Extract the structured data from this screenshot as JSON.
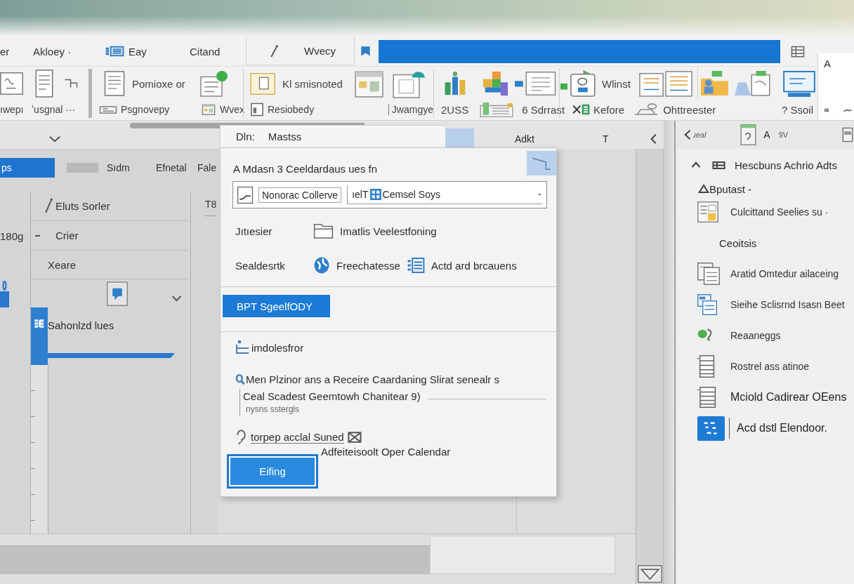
{
  "ribbon": {
    "tabs": [
      {
        "label": "er",
        "selected": false
      },
      {
        "label": "Akloey ·",
        "selected": false
      },
      {
        "label": "Eay",
        "selected": false
      },
      {
        "label": "Citand",
        "selected": false
      },
      {
        "label": "Wvecy",
        "selected": false
      }
    ],
    "top_commands": [
      "Pomioxe or",
      "Kl smisnoted",
      "Wlinst"
    ],
    "bottom_commands": [
      "ıwepı",
      "ʻusgnal ···",
      "Psgnovepy",
      "Wvex",
      "Resiobedy",
      "Jwamgye",
      "2USS",
      "6 Sdrrast",
      "Kefore",
      "Ohttreester",
      "? Ssoil"
    ],
    "side_label": "A"
  },
  "content_header": [
    "Adkt",
    "T"
  ],
  "calendar": {
    "tabs": [
      {
        "label": "ps",
        "selected": true
      },
      {
        "label": "Sıdm",
        "selected": false
      },
      {
        "label": "Efnetal",
        "selected": false
      },
      {
        "label": "Fale",
        "selected": false
      }
    ],
    "rows": [
      {
        "title": "Eluts Sorler",
        "column_3": "T8"
      },
      {
        "time": "180g",
        "title": "Crier"
      },
      {
        "title": "Xeare"
      }
    ],
    "event": {
      "title": "Sahonlzd lues"
    }
  },
  "dialog": {
    "title_label": "Dln:",
    "title": "Mastss",
    "heading": "A Mdasn 3 Ceeldardaus ues fn",
    "recipient": {
      "chip": "Nonorac Collerve",
      "value_start": "ıelT",
      "value_end": "Cemsel Soys"
    },
    "rows": [
      {
        "label": "Jıtıesier",
        "values": [
          "Imatlis Veelestfoning"
        ]
      },
      {
        "label": "Sealdesrtk",
        "values": [
          "Freechatesse",
          "Actd ard brcauens"
        ]
      }
    ],
    "section": "BPT SgeelfODY",
    "option": "imdolesfror",
    "description": "Men Plzinor ans a Receire Caardaning Slirat senealr s",
    "field_value": "Ceal Scadest Geemtowh Chanitear 9)",
    "helper": "nysns sstergls",
    "link": "torpep acclal Suned",
    "note": "Adfeiteisoolt Oper Calendar",
    "button": "Eifing"
  },
  "task_pane": {
    "toolbar": {
      "back": "ɹeal",
      "font": "A",
      "size": "9V"
    },
    "header": "Hescbuns Achrio Adts",
    "section": "Bputast -",
    "items": [
      {
        "kind": "item",
        "label": "Culcittand Seelies su ·"
      },
      {
        "kind": "subheading",
        "label": "Ceoitsis"
      },
      {
        "kind": "item",
        "label": "Aratid Omtedur ailaceing"
      },
      {
        "kind": "item",
        "label": "Sieihe Sclisrnd Isasn Beet"
      },
      {
        "kind": "item",
        "label": "Reaaneggs"
      },
      {
        "kind": "item",
        "label": "Rostrel ass atinoe"
      },
      {
        "kind": "large",
        "label": "Mciold Cadirear OEens"
      },
      {
        "kind": "large",
        "label": "Acd dstl Elendoor."
      }
    ]
  }
}
